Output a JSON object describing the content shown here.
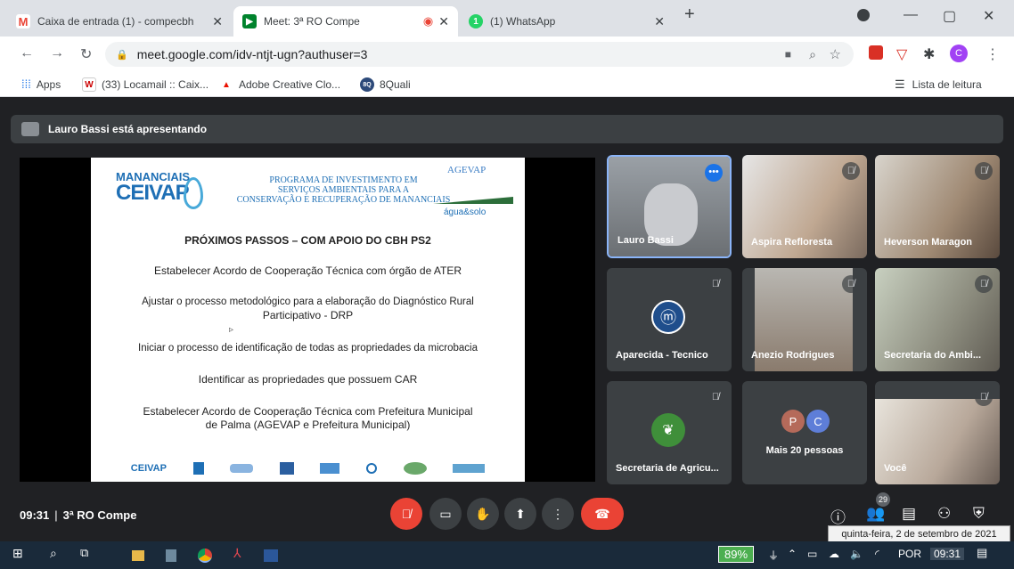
{
  "tabs": [
    {
      "title": "Caixa de entrada (1) - compecbh",
      "favicon": "M"
    },
    {
      "title": "Meet: 3ª RO Compe",
      "favicon": "▶"
    },
    {
      "title": "(1) WhatsApp",
      "favicon": "1"
    }
  ],
  "address": {
    "url": "meet.google.com/idv-ntjt-ugn?authuser=3"
  },
  "profile_initial": "C",
  "bookmarks": [
    {
      "label": "Apps"
    },
    {
      "label": "(33) Locamail :: Caix..."
    },
    {
      "label": "Adobe Creative Clo..."
    },
    {
      "label": "8Quali"
    }
  ],
  "reading_list": "Lista de leitura",
  "presenter_banner": "Lauro Bassi está apresentando",
  "slide": {
    "brand_left": "MANANCIAIS",
    "brand_left2": "CEIVAP",
    "header_l1": "PROGRAMA DE INVESTIMENTO EM",
    "header_l2": "SERVIÇOS AMBIENTAIS PARA A",
    "header_l3": "CONSERVAÇÃO E RECUPERAÇÃO DE MANANCIAIS",
    "brand_right": "AGEVAP",
    "brand_right2": "água&solo",
    "heading": "PRÓXIMOS PASSOS – COM APOIO DO CBH PS2",
    "items": [
      "Estabelecer Acordo de Cooperação Técnica com órgão de ATER",
      "Ajustar o processo metodológico para a elaboração do Diagnóstico Rural",
      "Participativo - DRP",
      "Iniciar o processo de identificação de todas as propriedades da microbacia",
      "Identificar as propriedades que possuem CAR",
      "Estabelecer Acordo de Cooperação Técnica com Prefeitura Municipal",
      "de Palma (AGEVAP e Prefeitura Municipal)"
    ],
    "footer_logo": "CEIVAP"
  },
  "participants": [
    {
      "name": "Lauro Bassi"
    },
    {
      "name": "Aspira Refloresta"
    },
    {
      "name": "Heverson Maragon"
    },
    {
      "name": "Aparecida - Tecnico"
    },
    {
      "name": "Anezio Rodrigues"
    },
    {
      "name": "Secretaria do Ambi..."
    },
    {
      "name": "Secretaria de Agricu..."
    },
    {
      "name": "Mais 20 pessoas",
      "avatars": [
        "P",
        "C"
      ]
    },
    {
      "name": "Você"
    }
  ],
  "meeting": {
    "time": "09:31",
    "separator": "|",
    "name": "3ª RO Compe",
    "participant_count": "29"
  },
  "taskbar": {
    "battery": "89%",
    "lang": "POR",
    "clock": "09:31",
    "tooltip": "quinta-feira, 2 de setembro de 2021"
  },
  "colors": {
    "end_call": "#ea4335",
    "mic_off": "#ea4335",
    "accent_blue": "#1a73e8"
  }
}
